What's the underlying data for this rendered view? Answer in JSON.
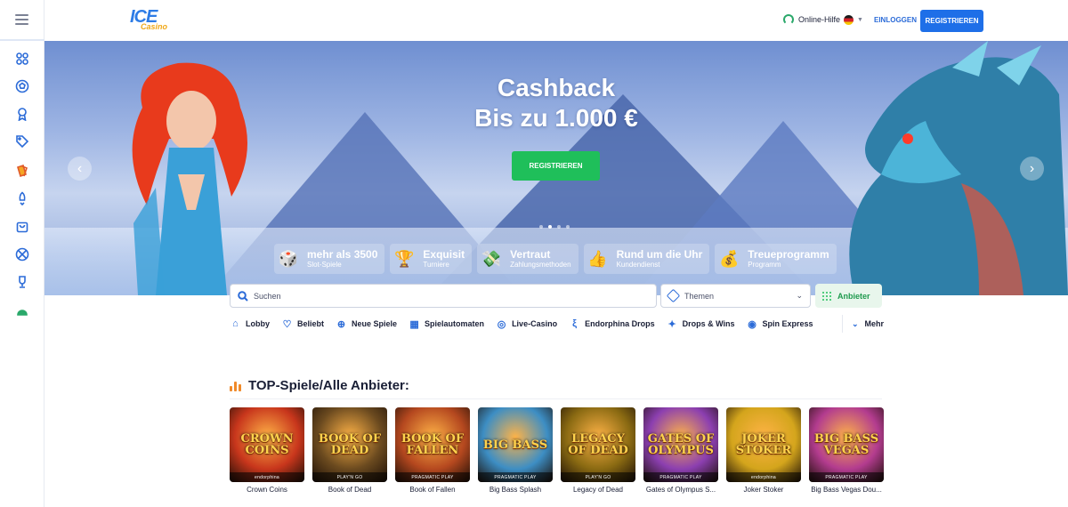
{
  "brand": {
    "logo_main": "ICE",
    "logo_sub": "Casino"
  },
  "header": {
    "help_label": "Online-Hilfe",
    "login_label": "EINLOGGEN",
    "register_label": "REGISTRIEREN"
  },
  "sidebar": {
    "items": [
      {
        "icon": "grid-icon"
      },
      {
        "icon": "football-icon"
      },
      {
        "icon": "award-icon"
      },
      {
        "icon": "tag-icon"
      },
      {
        "icon": "cards-icon"
      },
      {
        "icon": "rocket-icon"
      },
      {
        "icon": "bag-icon"
      },
      {
        "icon": "sports-ball-icon"
      },
      {
        "icon": "trophy-icon"
      },
      {
        "icon": "android-icon"
      }
    ]
  },
  "hero": {
    "title_line1": "Cashback",
    "title_line2": "Bis zu 1.000 €",
    "cta_label": "REGISTRIEREN",
    "active_slide": 2,
    "slide_count": 4,
    "features": [
      {
        "icon": "dice-icon",
        "title": "mehr als 3500",
        "subtitle": "Slot-Spiele"
      },
      {
        "icon": "trophy-icon",
        "title": "Exquisit",
        "subtitle": "Turniere"
      },
      {
        "icon": "money-icon",
        "title": "Vertraut",
        "subtitle": "Zahlungsmethoden"
      },
      {
        "icon": "thumbs-up-icon",
        "title": "Rund um die Uhr",
        "subtitle": "Kundendienst"
      },
      {
        "icon": "money-bag-icon",
        "title": "Treueprogramm",
        "subtitle": "Programm"
      }
    ]
  },
  "search": {
    "placeholder": "Suchen",
    "themes_label": "Themen",
    "providers_label": "Anbieter"
  },
  "categories": [
    {
      "icon": "home-icon",
      "label": "Lobby"
    },
    {
      "icon": "heart-icon",
      "label": "Beliebt"
    },
    {
      "icon": "plus-icon",
      "label": "Neue Spiele"
    },
    {
      "icon": "slot-machine-icon",
      "label": "Spielautomaten"
    },
    {
      "icon": "live-casino-icon",
      "label": "Live-Casino"
    },
    {
      "icon": "endorphina-icon",
      "label": "Endorphina Drops"
    },
    {
      "icon": "drops-wins-icon",
      "label": "Drops & Wins"
    },
    {
      "icon": "spin-express-icon",
      "label": "Spin Express"
    }
  ],
  "more_label": "Mehr",
  "top_games": {
    "title": "TOP-Spiele/Alle Anbieter:",
    "games": [
      {
        "name": "Crown Coins",
        "art_text": "CROWN COINS",
        "provider": "endorphina",
        "color": "#c8361c"
      },
      {
        "name": "Book of Dead",
        "art_text": "BOOK OF DEAD",
        "provider": "PLAY'N GO",
        "color": "#6b4a1f"
      },
      {
        "name": "Book of Fallen",
        "art_text": "BOOK OF FALLEN",
        "provider": "PRAGMATIC PLAY",
        "color": "#b5481f"
      },
      {
        "name": "Big Bass Splash",
        "art_text": "BIG BASS",
        "provider": "PRAGMATIC PLAY",
        "color": "#3d8ec4"
      },
      {
        "name": "Legacy of Dead",
        "art_text": "LEGACY OF DEAD",
        "provider": "PLAY'N GO",
        "color": "#8a6a12"
      },
      {
        "name": "Gates of Olympus S...",
        "art_text": "GATES OF OLYMPUS",
        "provider": "PRAGMATIC PLAY",
        "color": "#8c3fb0"
      },
      {
        "name": "Joker Stoker",
        "art_text": "JOKER STOKER",
        "provider": "endorphina",
        "color": "#d4a51c"
      },
      {
        "name": "Big Bass Vegas Dou...",
        "art_text": "BIG BASS VEGAS",
        "provider": "PRAGMATIC PLAY",
        "color": "#b33c8f"
      }
    ]
  },
  "colors": {
    "accent": "#1e6fe8",
    "cta_green": "#1fbf5a",
    "text": "#1a1f36"
  }
}
